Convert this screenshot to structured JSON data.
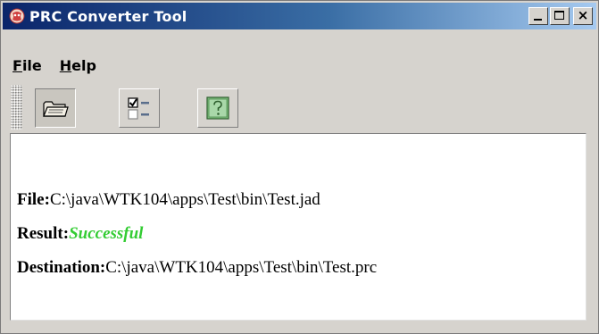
{
  "window": {
    "title": "PRC Converter Tool",
    "icon": "prc-app-icon",
    "controls": {
      "minimize_icon": "minimize-icon",
      "maximize_icon": "maximize-icon",
      "close_label": "×"
    }
  },
  "menu": {
    "items": [
      {
        "mnemonic": "F",
        "rest": "ile"
      },
      {
        "mnemonic": "H",
        "rest": "elp"
      }
    ]
  },
  "toolbar": {
    "buttons": [
      {
        "icon": "open-folder-icon",
        "state": "pressed"
      },
      {
        "icon": "checklist-options-icon",
        "state": "normal"
      },
      {
        "icon": "help-question-icon",
        "state": "normal"
      }
    ]
  },
  "result": {
    "file_label": "File:",
    "file_value": "C:\\java\\WTK104\\apps\\Test\\bin\\Test.jad",
    "result_label": "Result:",
    "result_value": "Successful",
    "dest_label": "Destination:",
    "dest_value": "C:\\java\\WTK104\\apps\\Test\\bin\\Test.prc"
  },
  "colors": {
    "title_gradient_start": "#0a246a",
    "title_gradient_end": "#a6caf0",
    "success": "#33cc33",
    "window_bg": "#d6d3ce"
  }
}
